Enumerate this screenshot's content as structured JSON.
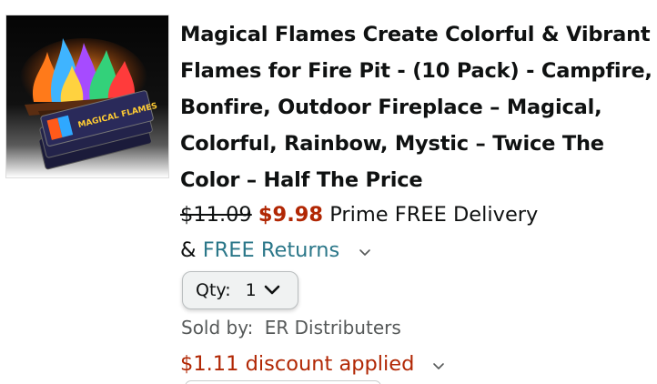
{
  "product": {
    "title": "Magical Flames Create Colorful & Vibrant Flames for Fire Pit - (10 Pack) - Campfire, Bonfire, Outdoor Fireplace – Magical, Colorful, Rainbow, Mystic – Twice The Color – Half The Price",
    "image_icon": "product-thumbnail",
    "package_label": "MAGICAL FLAMES"
  },
  "pricing": {
    "list_price": "$11.09",
    "sale_price": "$9.98",
    "delivery_text": "Prime FREE Delivery",
    "returns_prefix": "&",
    "returns_link": "FREE Returns",
    "sale_color": "#b12704",
    "link_color": "#2b7789"
  },
  "quantity": {
    "label": "Qty:",
    "value": "1"
  },
  "seller": {
    "label": "Sold by:",
    "name": "ER Distributers"
  },
  "discount": {
    "text": "$1.11 discount applied"
  }
}
